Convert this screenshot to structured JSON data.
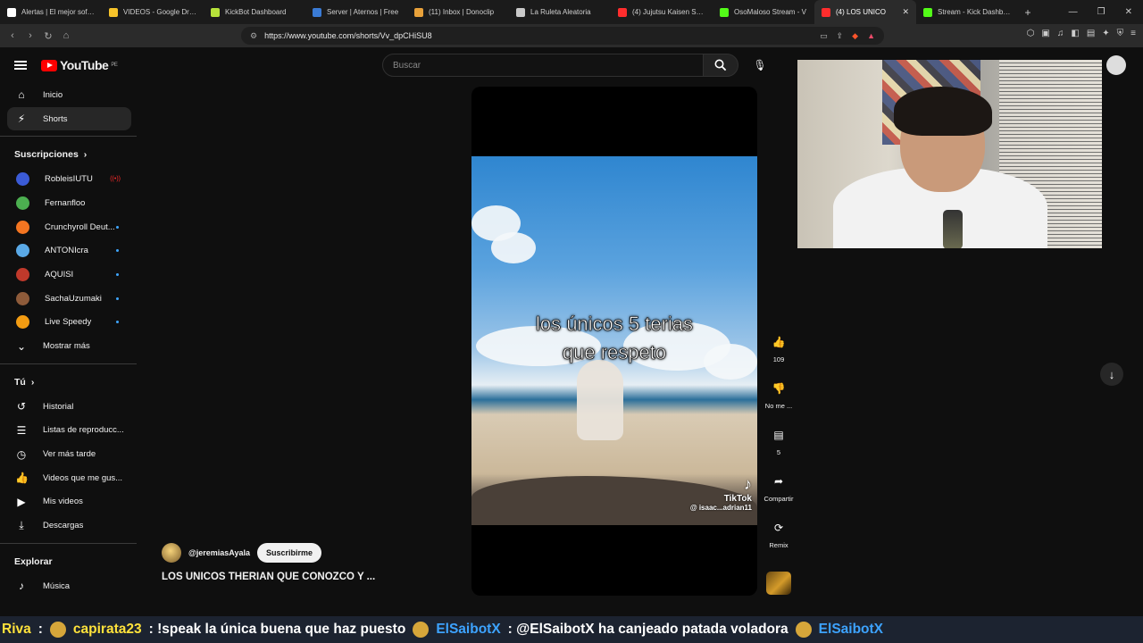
{
  "tabs": [
    {
      "label": "Alertas | El mejor softw...",
      "color": "#ffffff",
      "active": false
    },
    {
      "label": "VIDEOS - Google Drive",
      "color": "#f6c32a",
      "active": false
    },
    {
      "label": "KickBot Dashboard",
      "color": "#b6e23a",
      "active": false
    },
    {
      "label": "Server | Aternos | Free",
      "color": "#3a7bd5",
      "active": false
    },
    {
      "label": "(11) Inbox | Donoclip",
      "color": "#e8a13a",
      "active": false
    },
    {
      "label": "La Ruleta Aleatoria",
      "color": "#c9c9c9",
      "active": false
    },
    {
      "label": "(4) Jujutsu Kaisen Seas",
      "color": "#ff2d2d",
      "active": false
    },
    {
      "label": "OsoMaloso Stream - V",
      "color": "#53fc18",
      "active": false
    },
    {
      "label": "(4) LOS UNICO",
      "color": "#ff2d2d",
      "active": true
    },
    {
      "label": "Stream - Kick Dashboa",
      "color": "#53fc18",
      "active": false
    }
  ],
  "browser": {
    "url": "https://www.youtube.com/shorts/Vv_dpCHiSU8"
  },
  "header": {
    "logo_text": "YouTube",
    "region": "PE",
    "search_placeholder": "Buscar"
  },
  "sidebar": {
    "main": [
      {
        "label": "Inicio",
        "icon": "home-icon",
        "glyph": "⌂"
      },
      {
        "label": "Shorts",
        "icon": "shorts-icon",
        "glyph": "⚡"
      }
    ],
    "subscriptions_title": "Suscripciones",
    "subscriptions": [
      {
        "label": "RobleisIUTU",
        "color": "#3b5bd6",
        "badge": "live"
      },
      {
        "label": "Fernanfloo",
        "color": "#4caf50",
        "badge": "none"
      },
      {
        "label": "Crunchyroll Deut...",
        "color": "#f47521",
        "badge": "dot"
      },
      {
        "label": "ANTONIcra",
        "color": "#5aa9e6",
        "badge": "dot"
      },
      {
        "label": "AQUISI",
        "color": "#c0392b",
        "badge": "dot"
      },
      {
        "label": "SachaUzumaki",
        "color": "#8e5b3a",
        "badge": "dot"
      },
      {
        "label": "Live Speedy",
        "color": "#f39c12",
        "badge": "dot"
      }
    ],
    "show_more": "Mostrar más",
    "you_title": "Tú",
    "you_items": [
      {
        "label": "Historial",
        "icon": "history-icon",
        "glyph": "↺"
      },
      {
        "label": "Listas de reproducc...",
        "icon": "playlists-icon",
        "glyph": "☰"
      },
      {
        "label": "Ver más tarde",
        "icon": "watch-later-icon",
        "glyph": "◷"
      },
      {
        "label": "Videos que me gus...",
        "icon": "liked-videos-icon",
        "glyph": "👍"
      },
      {
        "label": "Mis videos",
        "icon": "my-videos-icon",
        "glyph": "▶"
      },
      {
        "label": "Descargas",
        "icon": "downloads-icon",
        "glyph": "⤓"
      }
    ],
    "explore_title": "Explorar",
    "explore_items": [
      {
        "label": "Música",
        "icon": "music-icon",
        "glyph": "♪"
      }
    ]
  },
  "short": {
    "caption_line1": "los únicos 5 terias",
    "caption_line2": "que respeto",
    "watermark_brand": "TikTok",
    "watermark_user": "@ isaac...adrian11",
    "channel": "@jeremiasAyala",
    "subscribe_label": "Suscribirme",
    "title": "LOS UNICOS THERIAN QUE CONOZCO Y ..."
  },
  "actions": [
    {
      "name": "like",
      "label": "109",
      "glyph": "👍"
    },
    {
      "name": "dislike",
      "label": "No me ...",
      "glyph": "👎"
    },
    {
      "name": "comments",
      "label": "5",
      "glyph": "▤"
    },
    {
      "name": "share",
      "label": "Compartir",
      "glyph": "➦"
    },
    {
      "name": "remix",
      "label": "Remix",
      "glyph": "⟳"
    }
  ],
  "chat": {
    "seg1_name": "Riva",
    "seg1_sep": ":",
    "seg2_name": "capirata23",
    "seg2_text": ": !speak la única buena que haz puesto",
    "seg3_name": "ElSaibotX",
    "seg3_text": ": @ElSaibotX ha canjeado patada voladora",
    "seg4_name": "ElSaibotX"
  }
}
